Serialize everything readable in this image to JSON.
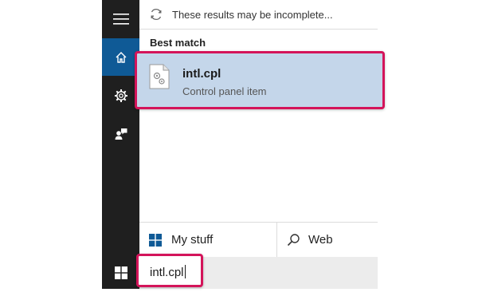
{
  "notice": {
    "text": "These results may be incomplete..."
  },
  "results": {
    "section_title": "Best match",
    "best_match": {
      "title": "intl.cpl",
      "subtitle": "Control panel item"
    }
  },
  "scope": {
    "my_stuff_label": "My stuff",
    "web_label": "Web"
  },
  "search": {
    "query": "intl.cpl"
  },
  "rail": {
    "items": [
      {
        "icon": "hamburger-menu-icon"
      },
      {
        "icon": "home-icon",
        "selected": true
      },
      {
        "icon": "gear-icon"
      },
      {
        "icon": "feedback-icon"
      }
    ]
  },
  "colors": {
    "rail_background": "#1f1f1f",
    "home_selected": "#0f5a96",
    "result_highlight": "#c4d6ea",
    "annotation_border": "#d4145a"
  }
}
